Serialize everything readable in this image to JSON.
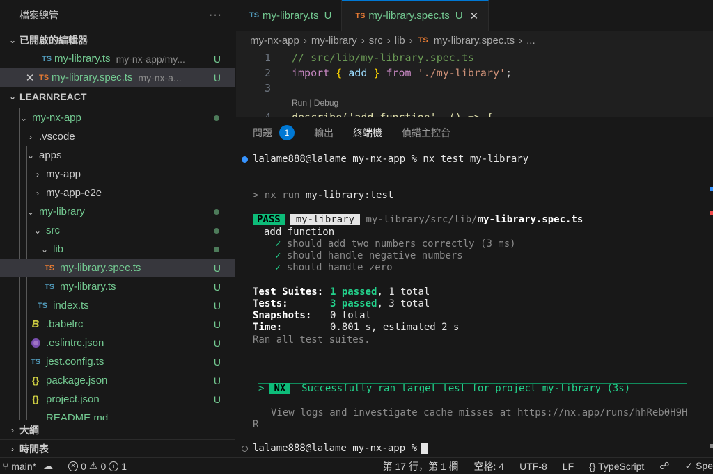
{
  "sidebar": {
    "title": "檔案總管",
    "more": "···",
    "open_editors": {
      "title": "已開啟的編輯器",
      "items": [
        {
          "icon": "TS",
          "name": "my-library.ts",
          "hint": "my-nx-app/my...",
          "status": "U"
        },
        {
          "icon": "TS",
          "name": "my-library.spec.ts",
          "hint": "my-nx-a...",
          "status": "U",
          "close": "✕"
        }
      ]
    },
    "workspace": {
      "title": "LEARNREACT",
      "tree": [
        {
          "name": "my-nx-app",
          "chev": "⌄"
        },
        {
          "name": ".vscode",
          "chev": "›"
        },
        {
          "name": "apps",
          "chev": "⌄"
        },
        {
          "name": "my-app",
          "chev": "›"
        },
        {
          "name": "my-app-e2e",
          "chev": "›"
        },
        {
          "name": "my-library",
          "chev": "⌄"
        },
        {
          "name": "src",
          "chev": "⌄"
        },
        {
          "name": "lib",
          "chev": "⌄"
        },
        {
          "name": "my-library.spec.ts",
          "icon": "TS",
          "status": "U"
        },
        {
          "name": "my-library.ts",
          "icon": "TS",
          "status": "U"
        },
        {
          "name": "index.ts",
          "icon": "TS",
          "status": "U"
        },
        {
          "name": ".babelrc",
          "icon": "B",
          "status": "U"
        },
        {
          "name": ".eslintrc.json",
          "status": "U"
        },
        {
          "name": "jest.config.ts",
          "icon": "TS",
          "status": "U"
        },
        {
          "name": "package.json",
          "icon": "{}",
          "status": "U"
        },
        {
          "name": "project.json",
          "icon": "{}",
          "status": "U"
        },
        {
          "name": "README.md"
        }
      ]
    },
    "outline": "大綱",
    "timeline": "時間表"
  },
  "editor": {
    "tabs": [
      {
        "icon": "TS",
        "name": "my-library.ts",
        "status": "U"
      },
      {
        "icon": "TS",
        "name": "my-library.spec.ts",
        "status": "U",
        "close": "✕"
      }
    ],
    "breadcrumbs": [
      "my-nx-app",
      "my-library",
      "src",
      "lib",
      "my-library.spec.ts",
      "..."
    ],
    "breadcrumb_icon": "TS",
    "lines": [
      {
        "num": "1",
        "comment": "// src/lib/my-library.spec.ts"
      },
      {
        "num": "2",
        "kw_import": "import",
        "brace_open": "{",
        "ident": "add",
        "brace_close": "}",
        "kw_from": "from",
        "str": "'./my-library'",
        "end": ";"
      },
      {
        "num": "3"
      },
      {
        "num": "4",
        "text": "describe('add function', () => {"
      }
    ],
    "codelens": "Run | Debug"
  },
  "panel": {
    "tabs": [
      {
        "label": "問題",
        "badge": "1"
      },
      {
        "label": "輸出"
      },
      {
        "label": "終端機"
      },
      {
        "label": "偵錯主控台"
      }
    ],
    "terminal": {
      "prompt1": "lalame888@lalame my-nx-app % nx test my-library",
      "run_arrow": ">",
      "run_cmd": "nx run",
      "run_target": "my-library:test",
      "pass": "PASS",
      "project_badge": "my-library",
      "spec_dir": "my-library/src/lib/",
      "spec_file": "my-library.spec.ts",
      "describe": "add function",
      "check": "✓",
      "tests": [
        "should add two numbers correctly (3 ms)",
        "should handle negative numbers",
        "should handle zero"
      ],
      "suites_label": "Test Suites:",
      "suites_passed": "1 passed",
      "suites_total": ", 1 total",
      "tests_label": "Tests:",
      "tests_passed": "3 passed",
      "tests_total": ", 3 total",
      "snapshots_label": "Snapshots:",
      "snapshots_value": "0 total",
      "time_label": "Time:",
      "time_value": "0.801 s, estimated 2 s",
      "ran_all": "Ran all test suites.",
      "nx_arrow": ">",
      "nx_badge": "NX",
      "nx_success": "Successfully ran target test for project my-library (3s)",
      "view_logs": "View logs and investigate cache misses at https://nx.app/runs/hhReb0H9H",
      "view_logs_wrap": "R",
      "prompt2": "lalame888@lalame my-nx-app %"
    }
  },
  "statusbar": {
    "branch": "main*",
    "errors": "0",
    "warnings": "0",
    "info": "1",
    "position": "第 17 行，第 1 欄",
    "spaces": "空格: 4",
    "encoding": "UTF-8",
    "eol": "LF",
    "language": "TypeScript",
    "spell": "Spe"
  },
  "colors": {
    "untracked": "#73c991",
    "accent": "#0078d4",
    "pass_badge": "#0dbc79"
  }
}
